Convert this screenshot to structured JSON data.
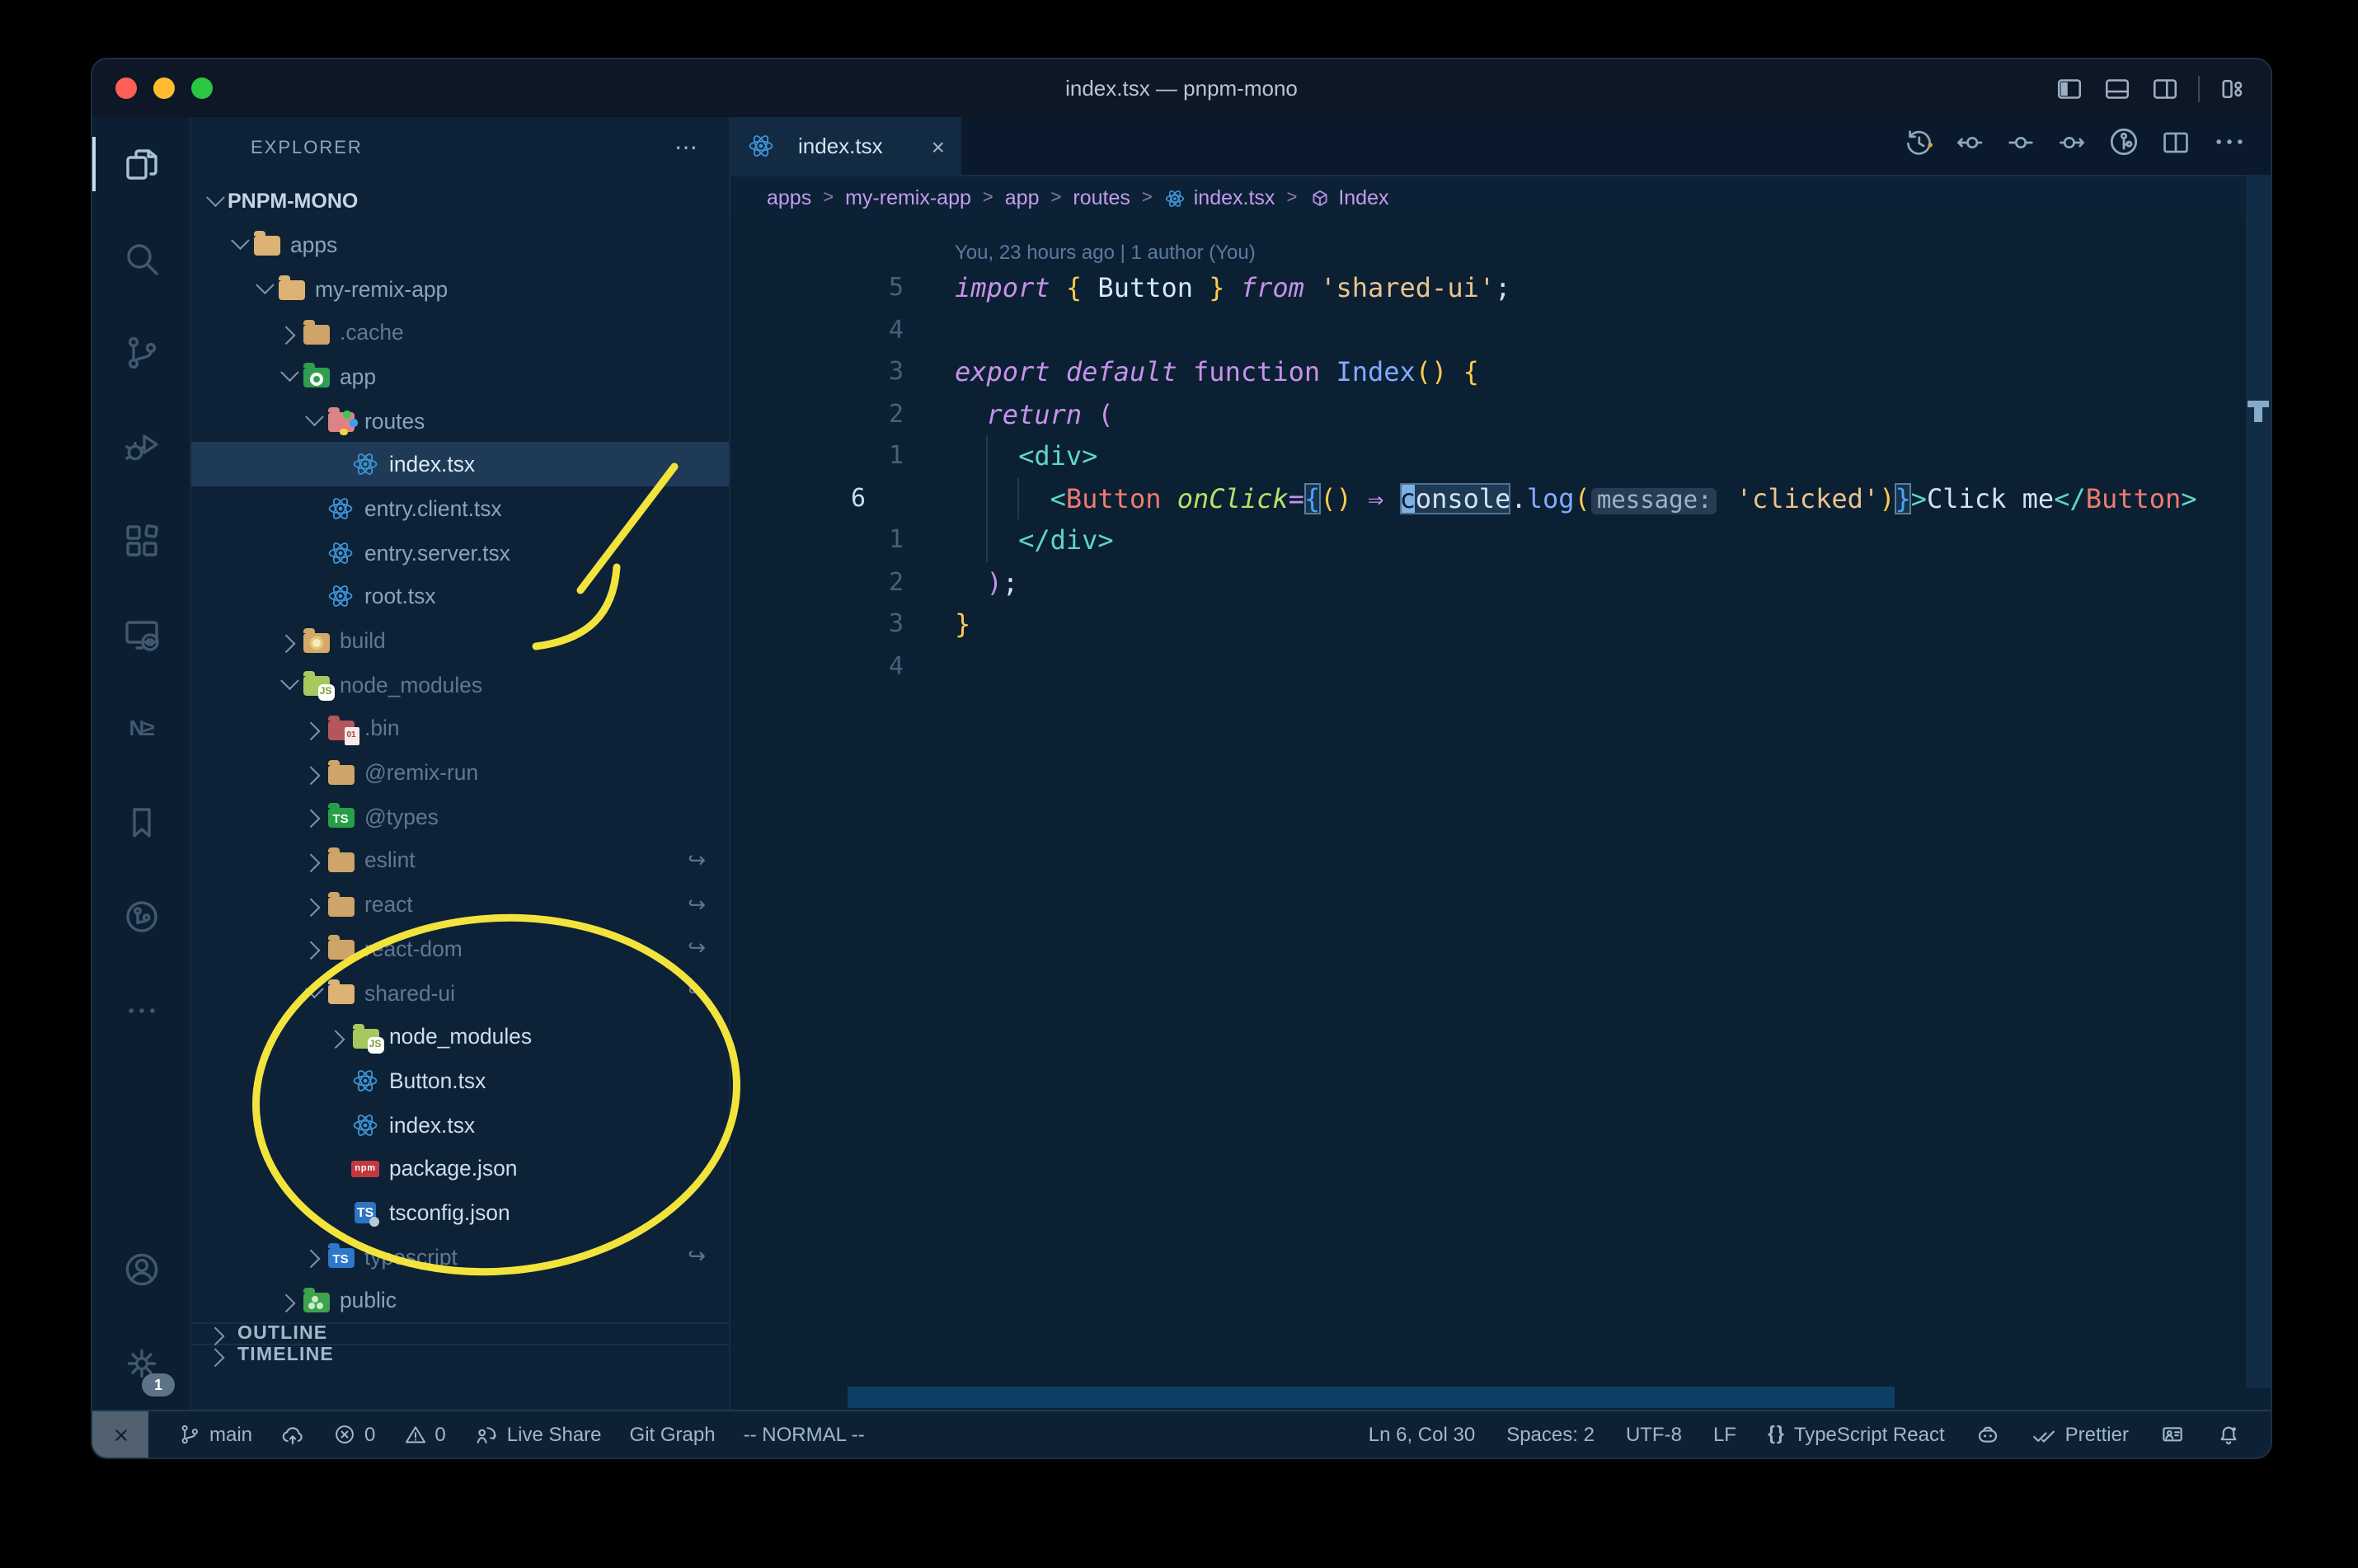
{
  "window": {
    "title": "index.tsx — pnpm-mono",
    "traffic_lights": [
      "#ff5f57",
      "#febc2e",
      "#28c840"
    ]
  },
  "titlebar": {
    "layout_icons": [
      {
        "name": "toggle-sidebar-left-icon",
        "icon": "layoutLeft"
      },
      {
        "name": "toggle-panel-icon",
        "icon": "layoutBottom"
      },
      {
        "name": "toggle-sidebar-right-icon",
        "icon": "layoutRight"
      },
      {
        "name": "customize-layout-icon",
        "icon": "layoutCustom",
        "divider_before": true
      }
    ]
  },
  "activity_bar": {
    "top": [
      {
        "name": "explorer",
        "icon": "files",
        "active": true
      },
      {
        "name": "search",
        "icon": "search"
      },
      {
        "name": "source-control",
        "icon": "scm"
      },
      {
        "name": "run-debug",
        "icon": "debug"
      },
      {
        "name": "extensions",
        "icon": "ext"
      },
      {
        "name": "remote-explorer",
        "icon": "remote"
      },
      {
        "name": "nx-console",
        "text": "N≥"
      },
      {
        "name": "bookmarks",
        "icon": "bookmark"
      },
      {
        "name": "gitlens",
        "icon": "gitlens"
      },
      {
        "name": "more-views",
        "icon": "ellipsis"
      }
    ],
    "bottom": [
      {
        "name": "accounts",
        "icon": "account"
      },
      {
        "name": "settings",
        "icon": "gear",
        "badge": "1"
      }
    ]
  },
  "sidebar": {
    "header": "EXPLORER",
    "header_menu": "⋯",
    "root": "PNPM-MONO",
    "symlink_glyph": "↪",
    "tree": [
      {
        "label": "apps",
        "lvl": 1,
        "chev": "v",
        "icon": "folder-open"
      },
      {
        "label": "my-remix-app",
        "lvl": 2,
        "chev": "v",
        "icon": "folder-open"
      },
      {
        "label": ".cache",
        "lvl": 3,
        "chev": "r",
        "icon": "folder",
        "dim": true
      },
      {
        "label": "app",
        "lvl": 3,
        "chev": "v",
        "icon": "folder-app"
      },
      {
        "label": "routes",
        "lvl": 4,
        "chev": "v",
        "icon": "folder-routes"
      },
      {
        "label": "index.tsx",
        "lvl": 5,
        "icon": "react",
        "selected": true
      },
      {
        "label": "entry.client.tsx",
        "lvl": 4,
        "icon": "react"
      },
      {
        "label": "entry.server.tsx",
        "lvl": 4,
        "icon": "react"
      },
      {
        "label": "root.tsx",
        "lvl": 4,
        "icon": "react"
      },
      {
        "label": "build",
        "lvl": 3,
        "chev": "r",
        "icon": "folder-build",
        "dim": true
      },
      {
        "label": "node_modules",
        "lvl": 3,
        "chev": "v",
        "icon": "folder-node",
        "dim": true
      },
      {
        "label": ".bin",
        "lvl": 4,
        "chev": "r",
        "icon": "folder-bin",
        "dim": true
      },
      {
        "label": "@remix-run",
        "lvl": 4,
        "chev": "r",
        "icon": "folder",
        "dim": true
      },
      {
        "label": "@types",
        "lvl": 4,
        "chev": "r",
        "icon": "folder-types",
        "dim": true
      },
      {
        "label": "eslint",
        "lvl": 4,
        "chev": "r",
        "icon": "folder",
        "dim": true,
        "symlink": true
      },
      {
        "label": "react",
        "lvl": 4,
        "chev": "r",
        "icon": "folder",
        "dim": true,
        "symlink": true
      },
      {
        "label": "react-dom",
        "lvl": 4,
        "chev": "r",
        "icon": "folder",
        "dim": true,
        "symlink": true
      },
      {
        "label": "shared-ui",
        "lvl": 4,
        "chev": "v",
        "icon": "folder-open",
        "dim": true,
        "symlink": true
      },
      {
        "label": "node_modules",
        "lvl": 5,
        "chev": "r",
        "icon": "folder-node",
        "bright": true
      },
      {
        "label": "Button.tsx",
        "lvl": 5,
        "icon": "react",
        "bright": true
      },
      {
        "label": "index.tsx",
        "lvl": 5,
        "icon": "react",
        "bright": true
      },
      {
        "label": "package.json",
        "lvl": 5,
        "icon": "npm",
        "bright": true
      },
      {
        "label": "tsconfig.json",
        "lvl": 5,
        "icon": "tsconfig",
        "bright": true
      },
      {
        "label": "typescript",
        "lvl": 4,
        "chev": "r",
        "icon": "folder-ts",
        "dim": true,
        "symlink": true
      },
      {
        "label": "public",
        "lvl": 3,
        "chev": "r",
        "icon": "folder-public"
      }
    ],
    "sections": [
      {
        "label": "OUTLINE"
      },
      {
        "label": "TIMELINE"
      }
    ]
  },
  "editor": {
    "tab": {
      "label": "index.tsx",
      "close": "×"
    },
    "breadcrumb_separator": ">",
    "breadcrumbs": [
      {
        "label": "apps"
      },
      {
        "label": "my-remix-app"
      },
      {
        "label": "app"
      },
      {
        "label": "routes"
      },
      {
        "label": "index.tsx",
        "icon": "reactSmall"
      },
      {
        "label": "Index",
        "icon": "symbolModule"
      }
    ],
    "codelens": "You, 23 hours ago | 1 author (You)",
    "actions": [
      {
        "name": "timeline-history",
        "icon": "history"
      },
      {
        "name": "previous-change",
        "icon": "circL"
      },
      {
        "name": "current-change",
        "icon": "circDash"
      },
      {
        "name": "next-change",
        "icon": "circR"
      },
      {
        "name": "git-graph-view",
        "icon": "gitCircle"
      },
      {
        "name": "split-editor",
        "icon": "split"
      },
      {
        "name": "more-actions",
        "icon": "ellipsis"
      }
    ]
  },
  "code": {
    "lines": [
      {
        "num": "5",
        "tokens": [
          [
            "kw",
            "import"
          ],
          [
            "txt",
            " "
          ],
          [
            "pun",
            "{"
          ],
          [
            "var",
            " Button "
          ],
          [
            "pun",
            "}"
          ],
          [
            "txt",
            " "
          ],
          [
            "kw",
            "from"
          ],
          [
            "txt",
            " "
          ],
          [
            "str",
            "'shared-ui'"
          ],
          [
            "txt",
            ";"
          ]
        ]
      },
      {
        "num": "4",
        "tokens": []
      },
      {
        "num": "3",
        "tokens": [
          [
            "kw",
            "export"
          ],
          [
            "txt",
            " "
          ],
          [
            "kw",
            "default"
          ],
          [
            "txt",
            " "
          ],
          [
            "kwf",
            "function"
          ],
          [
            "txt",
            " "
          ],
          [
            "fn",
            "Index"
          ],
          [
            "pun",
            "()"
          ],
          [
            "txt",
            " "
          ],
          [
            "pun",
            "{"
          ]
        ]
      },
      {
        "num": "2",
        "tokens": [
          [
            "txt",
            "  "
          ],
          [
            "kw",
            "return"
          ],
          [
            "pnk",
            " ("
          ]
        ]
      },
      {
        "num": "1",
        "tokens": [
          [
            "txt",
            "    "
          ],
          [
            "tag",
            "<div>"
          ]
        ]
      },
      {
        "num": "6",
        "active": true,
        "tokens": [
          [
            "txt",
            "      "
          ],
          [
            "tag",
            "<"
          ],
          [
            "cmp",
            "Button"
          ],
          [
            "txt",
            " "
          ],
          [
            "attr",
            "onClick"
          ],
          [
            "op",
            "="
          ],
          [
            "brc bm",
            "{"
          ],
          [
            "pun",
            "()"
          ],
          [
            "txt",
            " "
          ],
          [
            "op",
            "⇒"
          ],
          [
            "txt",
            " "
          ],
          {
            "group": "wh",
            "tokens": [
              [
                "cur",
                "c"
              ],
              [
                "txt",
                "onsole"
              ]
            ]
          },
          [
            "txt",
            "."
          ],
          [
            "fn",
            "log"
          ],
          [
            "pun",
            "("
          ],
          [
            "inlay",
            "message:"
          ],
          [
            "txt",
            " "
          ],
          [
            "str",
            "'clicked'"
          ],
          [
            "pun",
            ")"
          ],
          [
            "brc bm",
            "}"
          ],
          [
            "tag",
            ">"
          ],
          [
            "txt",
            "Click me"
          ],
          [
            "tag",
            "</"
          ],
          [
            "cmp",
            "Button"
          ],
          [
            "tag",
            ">"
          ]
        ]
      },
      {
        "num": "1",
        "tokens": [
          [
            "txt",
            "    "
          ],
          [
            "tag",
            "</div>"
          ]
        ]
      },
      {
        "num": "2",
        "tokens": [
          [
            "txt",
            "  "
          ],
          [
            "pnk",
            ")"
          ],
          [
            "txt",
            ";"
          ]
        ]
      },
      {
        "num": "3",
        "tokens": [
          [
            "pun",
            "}"
          ]
        ]
      },
      {
        "num": "4",
        "tokens": []
      }
    ]
  },
  "statusbar": {
    "left": [
      {
        "name": "remote",
        "icon": "remoteSm",
        "remote_box": true
      },
      {
        "name": "branch",
        "icon": "branch",
        "label": "main"
      },
      {
        "name": "sync",
        "icon": "cloudUp"
      },
      {
        "name": "errors",
        "icon": "err",
        "label": "0"
      },
      {
        "name": "warnings",
        "icon": "warn",
        "label": "0"
      },
      {
        "name": "live-share",
        "icon": "liveshare",
        "label": "Live Share"
      },
      {
        "name": "git-graph",
        "label": "Git Graph"
      },
      {
        "name": "vim-mode",
        "label": "-- NORMAL --"
      }
    ],
    "right": [
      {
        "name": "cursor-position",
        "label": "Ln 6, Col 30"
      },
      {
        "name": "indentation",
        "label": "Spaces: 2"
      },
      {
        "name": "encoding",
        "label": "UTF-8"
      },
      {
        "name": "eol",
        "label": "LF"
      },
      {
        "name": "language-mode",
        "icon_text": "{}",
        "label": "TypeScript React"
      },
      {
        "name": "copilot",
        "icon": "copilot"
      },
      {
        "name": "formatter",
        "icon": "checkdbl",
        "label": "Prettier"
      },
      {
        "name": "feedback",
        "icon": "feedback"
      },
      {
        "name": "notifications",
        "icon": "bell"
      }
    ]
  },
  "annotation": {
    "color": "#f2e43c"
  }
}
